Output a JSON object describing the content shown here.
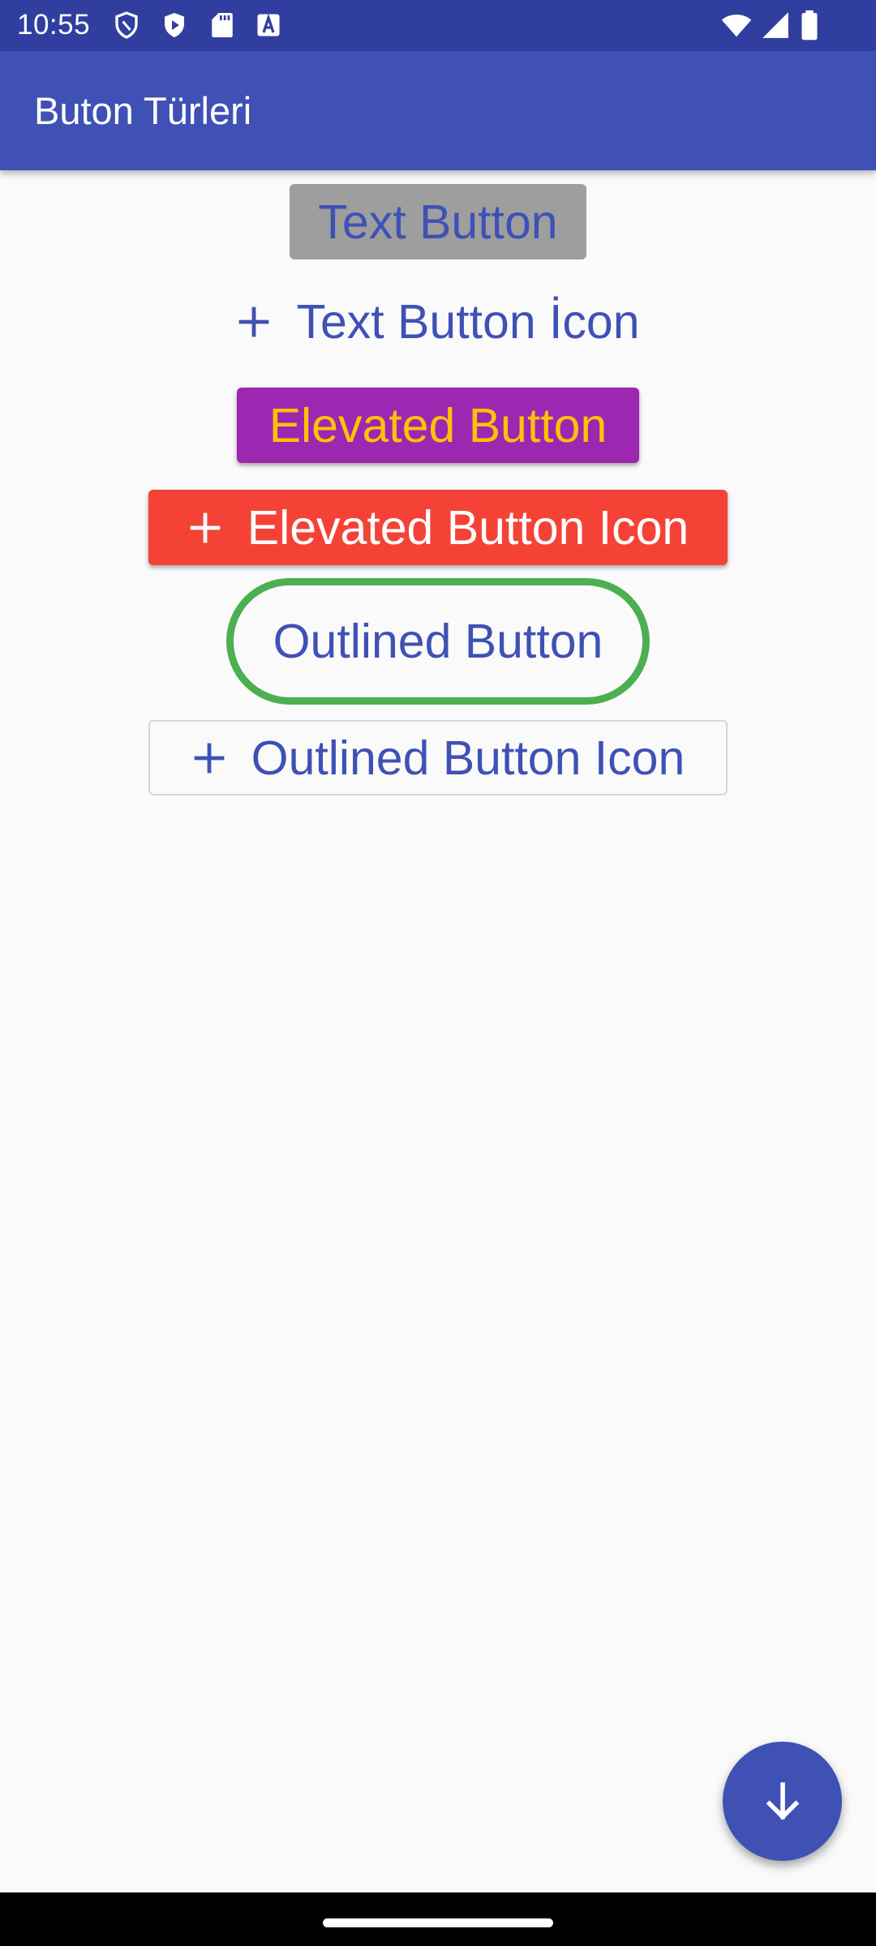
{
  "status_bar": {
    "time": "10:55",
    "icons_left": [
      "shield-icon",
      "play-protect-icon",
      "sd-card-icon",
      "a-box-icon"
    ],
    "icons_right": [
      "wifi-icon",
      "signal-icon",
      "battery-icon"
    ],
    "color": "#303F9F"
  },
  "app_bar": {
    "title": "Buton Türleri",
    "color": "#3F51B5"
  },
  "buttons": {
    "text_button": {
      "label": "Text Button",
      "bg": "#9E9E9E",
      "fg": "#3F51B5"
    },
    "text_button_icon": {
      "label": "Text Button İcon",
      "icon": "plus-icon",
      "fg": "#3F51B5"
    },
    "elevated_button": {
      "label": "Elevated Button",
      "bg": "#9C27B0",
      "fg": "#FFC107"
    },
    "elevated_button_icon": {
      "label": "Elevated Button Icon",
      "icon": "plus-icon",
      "bg": "#F44336",
      "fg": "#FFFFFF"
    },
    "outlined_button": {
      "label": "Outlined Button",
      "border": "#4CAF50",
      "fg": "#3F51B5"
    },
    "outlined_button_icon": {
      "label": "Outlined Button Icon",
      "icon": "plus-icon",
      "fg": "#3F51B5"
    }
  },
  "fab": {
    "icon": "arrow-down-icon",
    "color": "#3F51B5"
  },
  "nav_bar": {
    "handle": "home-pill"
  }
}
